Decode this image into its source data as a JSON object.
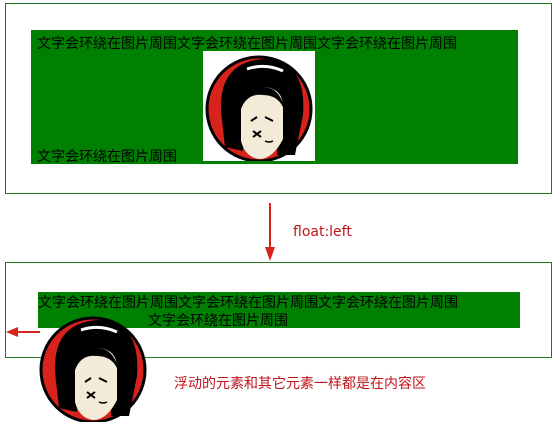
{
  "panel_top": {
    "text_line1": "文字会环绕在图片周围文字会环绕在图片周围文字会环绕在图片周围",
    "text_line2": "文字会环绕在图片周围"
  },
  "transition": {
    "label": "float:left"
  },
  "panel_bottom": {
    "text_line1": "文字会环绕在图片周围文字会环绕在图片周围文字会环绕在图片周围",
    "text_line2": "文字会环绕在图片周围"
  },
  "annotation": {
    "note": "浮动的元素和其它元素一样都是在内容区"
  },
  "colors": {
    "content_bg": "#008000",
    "border": "#1f7a1f",
    "accent_red": "#c0141b",
    "avatar_red": "#d8231c"
  },
  "icons": {
    "avatar": "girl-avatar-icon",
    "down_arrow": "arrow-down-icon",
    "left_arrow": "arrow-left-icon"
  }
}
